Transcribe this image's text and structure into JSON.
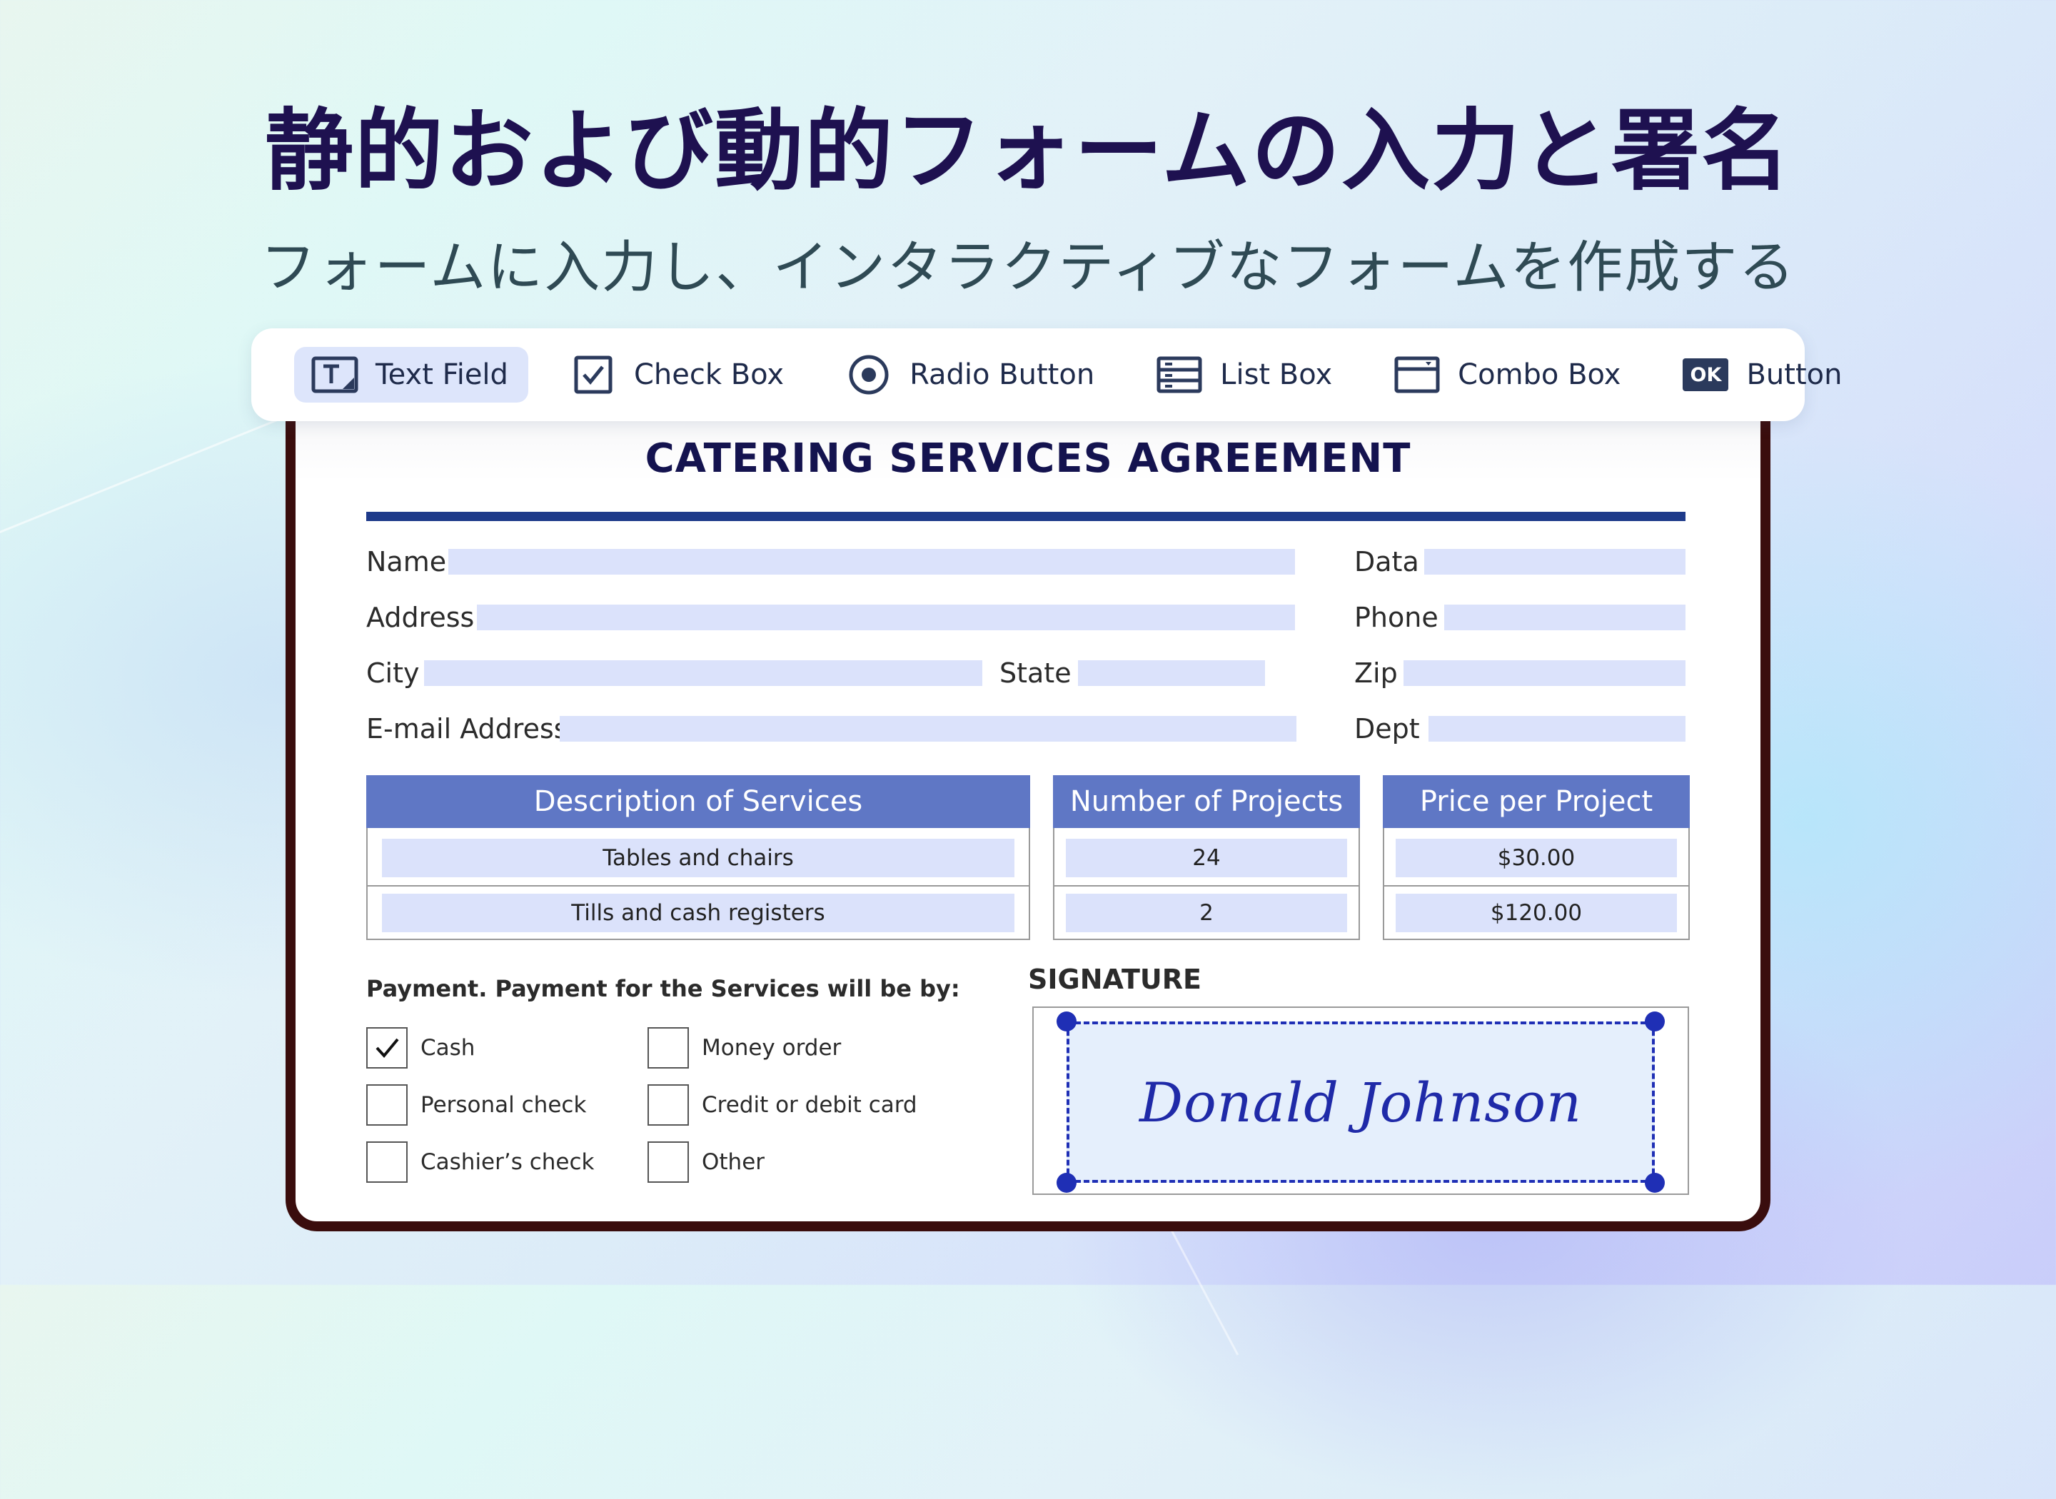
{
  "headline": "静的および動的フォームの入力と署名",
  "subheadline": "フォームに入力し、インタラクティブなフォームを作成する",
  "toolbar": {
    "items": [
      {
        "label": "Text Field",
        "icon": "text-field-icon",
        "active": true
      },
      {
        "label": "Check Box",
        "icon": "check-box-icon"
      },
      {
        "label": "Radio Button",
        "icon": "radio-button-icon"
      },
      {
        "label": "List Box",
        "icon": "list-box-icon"
      },
      {
        "label": "Combo Box",
        "icon": "combo-box-icon"
      },
      {
        "label": "Button",
        "icon": "button-icon",
        "icon_text": "OK"
      }
    ]
  },
  "document": {
    "title": "CATERING SERVICES AGREEMENT",
    "fields": {
      "name": "Name",
      "data": "Data",
      "address": "Address",
      "phone": "Phone",
      "city": "City",
      "state": "State",
      "zip": "Zip",
      "email": "E-mail Address",
      "dept": "Dept"
    },
    "table": {
      "headers": [
        "Description of Services",
        "Number of Projects",
        "Price per Project"
      ],
      "rows": [
        [
          "Tables and chairs",
          "24",
          "$30.00"
        ],
        [
          "Tills and cash registers",
          "2",
          "$120.00"
        ]
      ]
    },
    "payment": {
      "heading": "Payment. Payment for the Services will be by:",
      "options": [
        {
          "label": "Cash",
          "checked": true
        },
        {
          "label": "Money order",
          "checked": false
        },
        {
          "label": "Personal check",
          "checked": false
        },
        {
          "label": "Credit or debit card",
          "checked": false
        },
        {
          "label": "Cashier’s check",
          "checked": false
        },
        {
          "label": "Other",
          "checked": false
        }
      ]
    },
    "signature": {
      "heading": "SIGNATURE",
      "name": "Donald Johnson"
    }
  },
  "colors": {
    "accent": "#1e3a8a",
    "table_header": "#5f77c5",
    "field_fill": "#dbe2fb",
    "signature_ink": "#1f2aa8",
    "frame": "#3a0d0d"
  }
}
